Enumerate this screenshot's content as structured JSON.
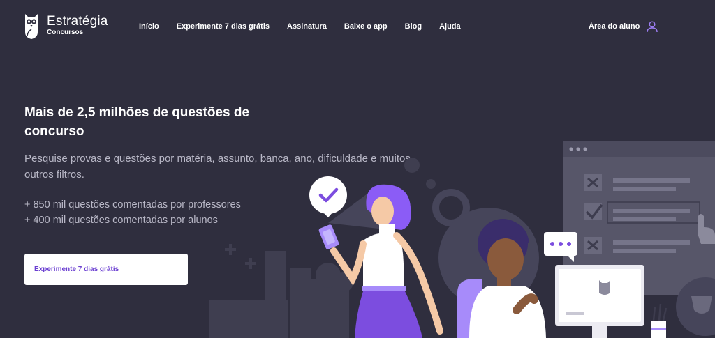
{
  "brand": {
    "name": "Estratégia",
    "subtitle": "Concursos"
  },
  "nav": {
    "items": [
      {
        "label": "Início"
      },
      {
        "label": "Experimente 7 dias grátis"
      },
      {
        "label": "Assinatura"
      },
      {
        "label": "Baixe o app"
      },
      {
        "label": "Blog"
      },
      {
        "label": "Ajuda"
      }
    ],
    "student_area": "Área do aluno",
    "student_icon": "user-icon"
  },
  "hero": {
    "title": "Mais de 2,5 milhões de questões de concurso",
    "description": "Pesquise provas e questões por matéria, assunto, banca, ano, dificuldade e muitos outros filtros.",
    "stats": [
      "+ 850 mil questões comentadas por professores",
      "+ 400 mil questões comentadas por alunos"
    ],
    "cta": "Experimente 7 dias grátis"
  },
  "colors": {
    "background": "#2f2e3e",
    "accent": "#7c4ddf",
    "cta_text": "#6b3fd1",
    "muted_text": "#b9b8c7"
  }
}
